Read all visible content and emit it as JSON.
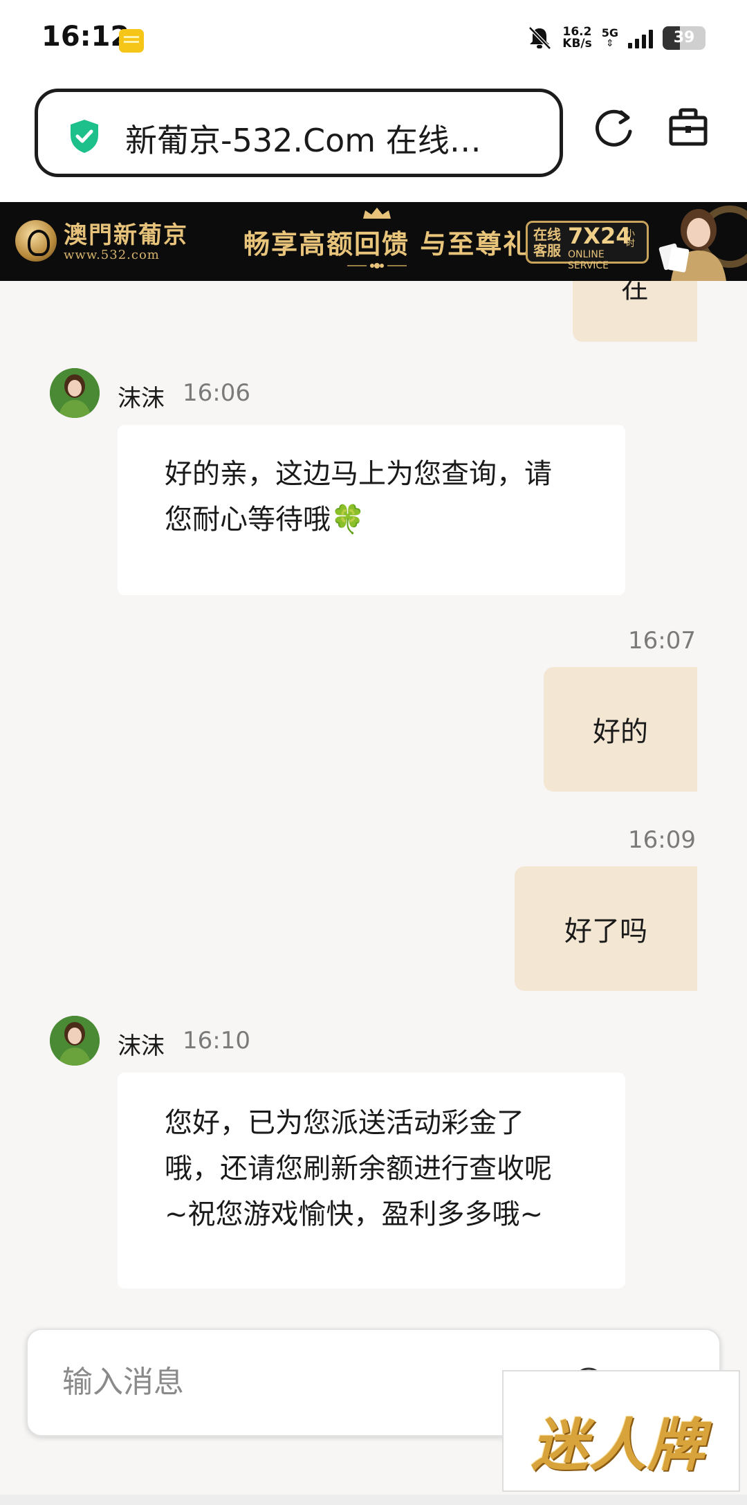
{
  "status_bar": {
    "time": "16:12",
    "net_speed_value": "16.2",
    "net_speed_unit": "KB/s",
    "network": "5G",
    "battery": "39"
  },
  "browser": {
    "url_title": "新葡京-532.Com 在线…",
    "secure_icon": "shield-check-icon",
    "reload_icon": "reload-icon",
    "toolbox_icon": "briefcase-icon",
    "accent_color": "#1dbf8a"
  },
  "banner": {
    "brand": "澳門新葡京",
    "url": "www.532.com",
    "slogan": "畅享高额回馈 与至尊礼遇",
    "service_left_1": "在线",
    "service_left_2": "客服",
    "service_hours": "7X24",
    "service_unit_1": "小",
    "service_unit_2": "时",
    "service_sub": "ONLINE SERVICE"
  },
  "chat": {
    "partial_char": "在",
    "messages": [
      {
        "sender": "沫沫",
        "time": "16:06",
        "text_lines": [
          "好的亲，这边马上为您查询，请",
          "您耐心等待哦🍀"
        ]
      },
      {
        "sender": "user",
        "time": "16:07",
        "text": "好的"
      },
      {
        "sender": "user",
        "time": "16:09",
        "text": "好了吗"
      },
      {
        "sender": "沫沫",
        "time": "16:10",
        "text_lines": [
          "您好，已为您派送活动彩金了",
          "哦，还请您刷新余额进行查收呢",
          "~祝您游戏愉快，盈利多多哦~"
        ]
      }
    ]
  },
  "input": {
    "placeholder": "输入消息"
  },
  "watermark": {
    "text": "迷人牌"
  }
}
